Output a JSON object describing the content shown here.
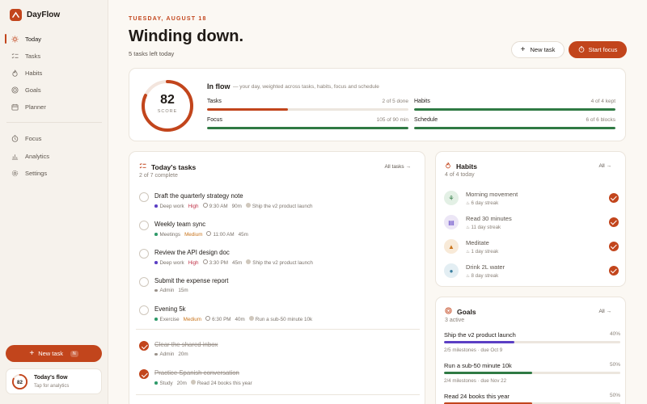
{
  "app": {
    "name": "DayFlow"
  },
  "colors": {
    "accent": "#c2451c",
    "success": "#2f7a44",
    "goal_purple": "#5b3fc4",
    "goal_green": "#2f7a44"
  },
  "sidebar": {
    "primary": [
      {
        "label": "Today",
        "icon": "sun-icon",
        "active": true
      },
      {
        "label": "Tasks",
        "icon": "list-check-icon"
      },
      {
        "label": "Habits",
        "icon": "flame-icon"
      },
      {
        "label": "Goals",
        "icon": "target-icon"
      },
      {
        "label": "Planner",
        "icon": "calendar-icon"
      }
    ],
    "secondary": [
      {
        "label": "Focus",
        "icon": "timer-icon"
      },
      {
        "label": "Analytics",
        "icon": "chart-icon"
      },
      {
        "label": "Settings",
        "icon": "gear-icon"
      }
    ],
    "new_task": {
      "label": "New task",
      "shortcut": "N"
    },
    "flow_card": {
      "score": "82",
      "title": "Today's flow",
      "subtitle": "Tap for analytics"
    }
  },
  "header": {
    "date": "TUESDAY, AUGUST 18",
    "title": "Winding down.",
    "subtitle": "5 tasks left today",
    "new_task_label": "New task",
    "start_focus_label": "Start focus"
  },
  "flow": {
    "score": "82",
    "score_label": "SCORE",
    "score_fraction": 0.82,
    "title": "In flow",
    "description": "— your day, weighted across tasks, habits, focus and schedule",
    "metrics": {
      "tasks": {
        "label": "Tasks",
        "value": "2 of 5 done",
        "fraction": 0.4
      },
      "habits": {
        "label": "Habits",
        "value": "4 of 4 kept",
        "fraction": 1.0
      },
      "focus": {
        "label": "Focus",
        "value": "105 of 90 min",
        "fraction": 1.0
      },
      "schedule": {
        "label": "Schedule",
        "value": "6 of 6 blocks",
        "fraction": 1.0
      }
    }
  },
  "tasks": {
    "title": "Today's tasks",
    "subtitle": "2 of 7 complete",
    "link": "All tasks →",
    "items": [
      {
        "title": "Draft the quarterly strategy note",
        "category": "Deep work",
        "category_color": "#5b3fc4",
        "priority": "High",
        "time": "9:30 AM",
        "duration": "90m",
        "goal": "Ship the v2 product launch",
        "done": false
      },
      {
        "title": "Weekly team sync",
        "category": "Meetings",
        "category_color": "#2f9a6a",
        "priority": "Medium",
        "time": "11:00 AM",
        "duration": "45m",
        "goal": "",
        "done": false
      },
      {
        "title": "Review the API design doc",
        "category": "Deep work",
        "category_color": "#5b3fc4",
        "priority": "High",
        "time": "3:30 PM",
        "duration": "45m",
        "goal": "Ship the v2 product launch",
        "done": false
      },
      {
        "title": "Submit the expense report",
        "category": "Admin",
        "category_color": "#9a9189",
        "priority": "",
        "time": "",
        "duration": "15m",
        "goal": "",
        "done": false
      },
      {
        "title": "Evening 5k",
        "category": "Exercise",
        "category_color": "#2f9a6a",
        "priority": "Medium",
        "time": "6:30 PM",
        "duration": "40m",
        "goal": "Run a sub-50 minute 10k",
        "done": false
      },
      {
        "title": "Clear the shared inbox",
        "category": "Admin",
        "category_color": "#9a9189",
        "priority": "",
        "time": "",
        "duration": "20m",
        "goal": "",
        "done": true
      },
      {
        "title": "Practice Spanish conversation",
        "category": "Study",
        "category_color": "#2f9a6a",
        "priority": "",
        "time": "",
        "duration": "20m",
        "goal": "Read 24 books this year",
        "done": true
      }
    ]
  },
  "habits": {
    "title": "Habits",
    "subtitle": "4 of 4 today",
    "link": "All →",
    "items": [
      {
        "name": "Morning movement",
        "streak": "6 day streak",
        "icon": "walk-icon",
        "bg": "#e3f0e5",
        "fg": "#2f7a44",
        "glyph": "⚘"
      },
      {
        "name": "Read 30 minutes",
        "streak": "11 day streak",
        "icon": "book-icon",
        "bg": "#ece6f6",
        "fg": "#5b3fc4",
        "glyph": "▤"
      },
      {
        "name": "Meditate",
        "streak": "1 day streak",
        "icon": "lotus-icon",
        "bg": "#f8ead8",
        "fg": "#c9741c",
        "glyph": "▲"
      },
      {
        "name": "Drink 2L water",
        "streak": "8 day streak",
        "icon": "droplet-icon",
        "bg": "#e3eef3",
        "fg": "#3a7fa0",
        "glyph": "●"
      }
    ]
  },
  "goals": {
    "title": "Goals",
    "subtitle": "3 active",
    "link": "All →",
    "items": [
      {
        "name": "Ship the v2 product launch",
        "pct": "40%",
        "fraction": 0.4,
        "color": "#5b3fc4",
        "meta": "2/5 milestones · due Oct 9"
      },
      {
        "name": "Run a sub-50 minute 10k",
        "pct": "50%",
        "fraction": 0.5,
        "color": "#2f7a44",
        "meta": "2/4 milestones · due Nov 22"
      },
      {
        "name": "Read 24 books this year",
        "pct": "50%",
        "fraction": 0.5,
        "color": "#c2451c",
        "meta": ""
      }
    ]
  }
}
